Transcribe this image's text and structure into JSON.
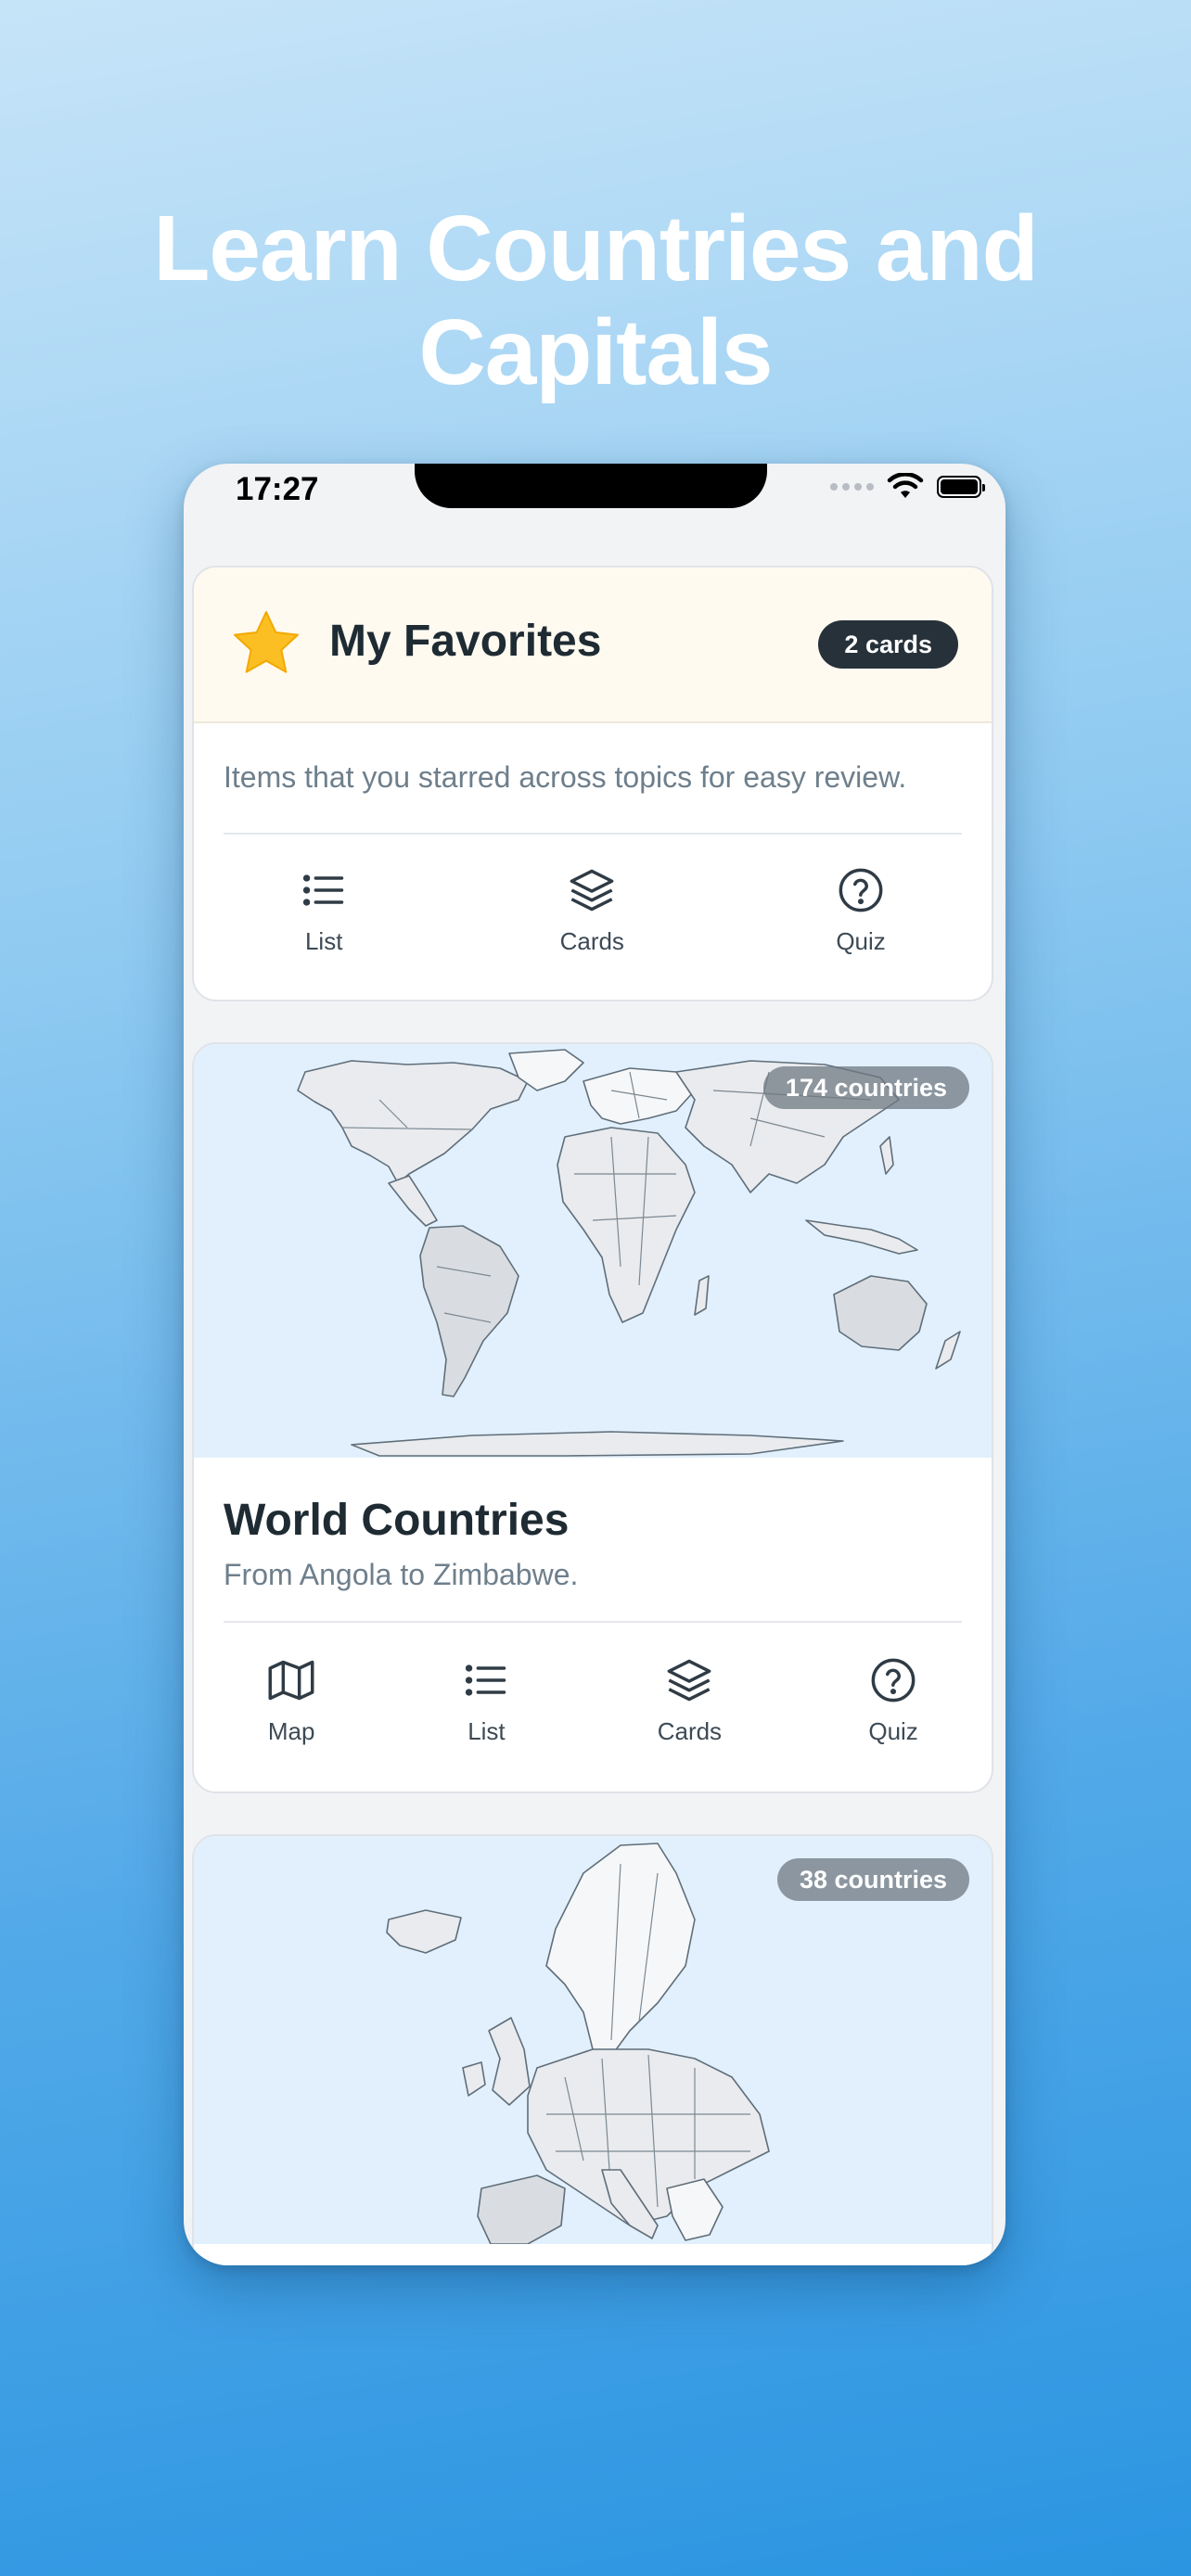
{
  "headline": {
    "line1": "Learn Countries and",
    "line2": "Capitals"
  },
  "status_bar": {
    "time": "17:27"
  },
  "favorites": {
    "title": "My Favorites",
    "badge": "2 cards",
    "description": "Items that you starred across topics for easy review.",
    "actions": [
      {
        "label": "List",
        "icon": "list-icon"
      },
      {
        "label": "Cards",
        "icon": "layers-icon"
      },
      {
        "label": "Quiz",
        "icon": "question-circle-icon"
      }
    ]
  },
  "world": {
    "badge": "174 countries",
    "title": "World Countries",
    "subtitle": "From Angola to Zimbabwe.",
    "actions": [
      {
        "label": "Map",
        "icon": "map-icon"
      },
      {
        "label": "List",
        "icon": "list-icon"
      },
      {
        "label": "Cards",
        "icon": "layers-icon"
      },
      {
        "label": "Quiz",
        "icon": "question-circle-icon"
      }
    ]
  },
  "europe": {
    "badge": "38 countries"
  },
  "colors": {
    "star": "#fbbf24",
    "pill_dark": "#26313a",
    "map_water": "#e1f0fc",
    "text_primary": "#1f2b33",
    "text_secondary": "#6e7f8c"
  }
}
